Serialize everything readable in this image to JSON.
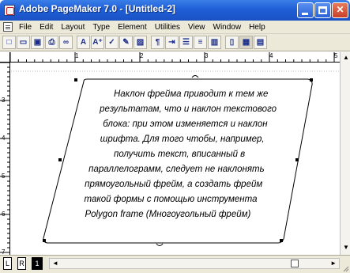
{
  "window": {
    "title": "Adobe PageMaker 7.0 - [Untitled-2]",
    "accent": "#1f5fd6"
  },
  "menubar": {
    "items": [
      "File",
      "Edit",
      "Layout",
      "Type",
      "Element",
      "Utilities",
      "View",
      "Window",
      "Help"
    ]
  },
  "toolbar": {
    "buttons": [
      {
        "name": "new-document",
        "icon": "new-document-icon",
        "glyph": "□"
      },
      {
        "name": "open",
        "icon": "open-folder-icon",
        "glyph": "▭"
      },
      {
        "name": "save",
        "icon": "save-icon",
        "glyph": "▣"
      },
      {
        "name": "print",
        "icon": "print-icon",
        "glyph": "⎙"
      },
      {
        "name": "find",
        "icon": "binoculars-icon",
        "glyph": "∞"
      },
      {
        "name": "type",
        "icon": "text-tool-icon",
        "glyph": "A"
      },
      {
        "name": "type-superscript",
        "icon": "text-superscript-icon",
        "glyph": "A⁺"
      },
      {
        "name": "spell",
        "icon": "spell-check-icon",
        "glyph": "✓"
      },
      {
        "name": "hyphen",
        "icon": "hyphenation-icon",
        "glyph": "✎"
      },
      {
        "name": "image",
        "icon": "image-icon",
        "glyph": "▨"
      },
      {
        "name": "paragraph",
        "icon": "paragraph-icon",
        "glyph": "¶"
      },
      {
        "name": "indent",
        "icon": "indent-icon",
        "glyph": "⇥"
      },
      {
        "name": "bullets",
        "icon": "bullets-icon",
        "glyph": "☰"
      },
      {
        "name": "align",
        "icon": "align-icon",
        "glyph": "≡"
      },
      {
        "name": "columns",
        "icon": "columns-icon",
        "glyph": "▥"
      },
      {
        "name": "page-setup",
        "icon": "page-icon",
        "glyph": "▯"
      },
      {
        "name": "story-editor",
        "icon": "story-editor-icon",
        "glyph": "▦"
      },
      {
        "name": "styles",
        "icon": "styles-icon",
        "glyph": "▤"
      }
    ]
  },
  "rulers": {
    "top_labels": [
      "1",
      "2",
      "3",
      "4",
      "5"
    ],
    "left_labels": [
      "3",
      "4",
      "5",
      "6",
      "7"
    ]
  },
  "frame": {
    "text": "Наклон фрейма приводит к тем же результатам, что и наклон текстового блока: при этом изменяется и наклон шрифта. Для того чтобы, например, получить текст, вписанный в параллелограмм, следует не наклонять прямоугольный фрейм, а создать фрейм такой формы с помощью инструмента Polygon frame (Многоугольный фрейм)",
    "lines": [
      "Наклон фрейма приводит к тем же",
      "результатам, что и наклон текстового",
      "блока: при этом изменяется и наклон",
      "шрифта. Для того чтобы, например,",
      "получить текст, вписанный в",
      "параллелограмм, следует не наклонять",
      "прямоугольный фрейм, а создать фрейм",
      "такой формы с помощью инструмента",
      "Polygon frame (Многоугольный фрейм)"
    ]
  },
  "pages": {
    "left": "L",
    "right": "R",
    "current": "1"
  }
}
